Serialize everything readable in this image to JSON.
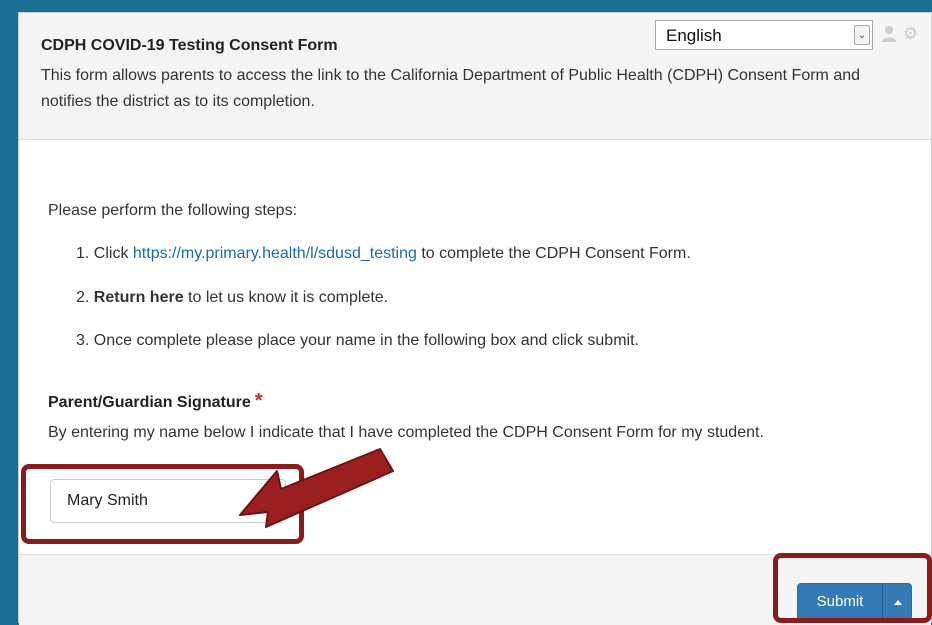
{
  "header": {
    "title": "CDPH COVID-19 Testing Consent Form",
    "description": "This form allows parents to access the link to the California Department of Public Health (CDPH) Consent Form and notifies the district as to its completion.",
    "language_selected": "English",
    "icons": [
      "user-icon",
      "gear-icon"
    ]
  },
  "instructions": {
    "intro": "Please perform the following steps:",
    "step1_prefix": "1. Click ",
    "step1_link": "https://my.primary.health/l/sdusd_testing",
    "step1_suffix": " to complete the CDPH Consent Form.",
    "step2_prefix": "2. ",
    "step2_bold": "Return here",
    "step2_suffix": " to let us know it is complete.",
    "step3": "3. Once complete please place your name in the following box and click submit."
  },
  "signature": {
    "label": "Parent/Guardian Signature",
    "required_mark": "*",
    "help": "By entering my name below I indicate that I have completed the CDPH Consent Form for my student.",
    "value": "Mary Smith"
  },
  "footer": {
    "submit_label": "Submit",
    "caret_icon": "caret-up-icon"
  },
  "colors": {
    "frame": "#1a6e94",
    "link": "#1a6bb0",
    "primary_button": "#337ab7",
    "required": "#d9232d",
    "annotation": "#8b1a1a"
  }
}
